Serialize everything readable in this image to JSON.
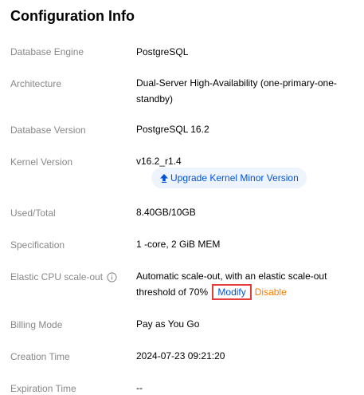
{
  "title": "Configuration Info",
  "rows": {
    "engine": {
      "label": "Database Engine",
      "value": "PostgreSQL"
    },
    "architecture": {
      "label": "Architecture",
      "value": "Dual-Server High-Availability (one-primary-one-standby)"
    },
    "version": {
      "label": "Database Version",
      "value": "PostgreSQL 16.2"
    },
    "kernel": {
      "label": "Kernel Version",
      "value": "v16.2_r1.4",
      "upgrade_label": "Upgrade Kernel Minor Version"
    },
    "used": {
      "label": "Used/Total",
      "value": "8.40GB/10GB"
    },
    "spec": {
      "label": "Specification",
      "value": "1 -core, 2 GiB MEM"
    },
    "elastic": {
      "label": "Elastic CPU scale-out",
      "value": "Automatic scale-out, with an elastic scale-out threshold of 70%",
      "modify_label": "Modify",
      "disable_label": "Disable"
    },
    "billing": {
      "label": "Billing Mode",
      "value": "Pay as You Go"
    },
    "created": {
      "label": "Creation Time",
      "value": "2024-07-23 09:21:20"
    },
    "expiration": {
      "label": "Expiration Time",
      "value": "--"
    }
  },
  "colors": {
    "link": "#0052d9",
    "disable": "#ff7d00",
    "highlight_box": "#e63c3c",
    "upgrade_bg": "#eef4fd"
  }
}
